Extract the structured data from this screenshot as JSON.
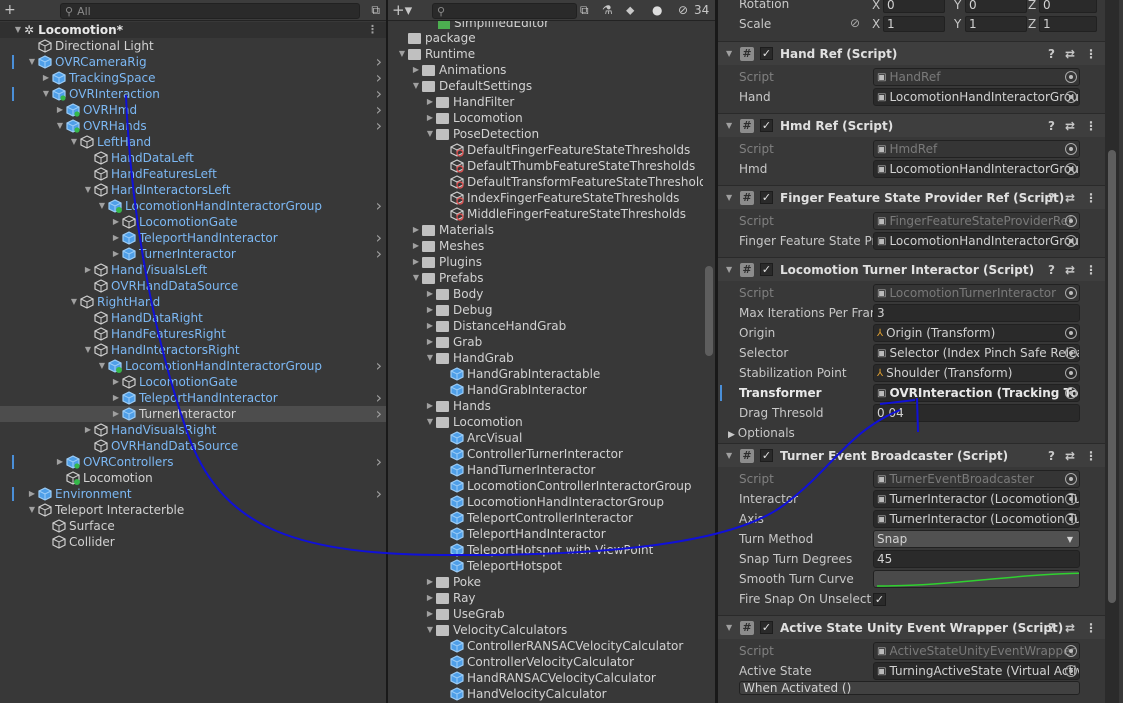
{
  "hierarchy": {
    "search_placeholder": "All",
    "scene": "Locomotion*",
    "rows": [
      {
        "label": "Directional Light",
        "indent": 1,
        "icon": "cube",
        "color": "white",
        "arrow": ""
      },
      {
        "label": "OVRCameraRig",
        "indent": 1,
        "icon": "prefab",
        "color": "blue",
        "arrow": "down",
        "chev": true,
        "mark": true
      },
      {
        "label": "TrackingSpace",
        "indent": 2,
        "icon": "prefab",
        "color": "blue",
        "arrow": "right",
        "chev": true
      },
      {
        "label": "OVRInteraction",
        "indent": 2,
        "icon": "prefab-mod",
        "color": "blue",
        "arrow": "down",
        "chev": true,
        "mark": true
      },
      {
        "label": "OVRHmd",
        "indent": 3,
        "icon": "prefab-mod",
        "color": "blue",
        "arrow": "right",
        "chev": true
      },
      {
        "label": "OVRHands",
        "indent": 3,
        "icon": "prefab-mod",
        "color": "blue",
        "arrow": "down",
        "chev": true
      },
      {
        "label": "LeftHand",
        "indent": 4,
        "icon": "cube",
        "color": "blue",
        "arrow": "down"
      },
      {
        "label": "HandDataLeft",
        "indent": 5,
        "icon": "cube",
        "color": "blue",
        "arrow": ""
      },
      {
        "label": "HandFeaturesLeft",
        "indent": 5,
        "icon": "cube",
        "color": "blue",
        "arrow": ""
      },
      {
        "label": "HandInteractorsLeft",
        "indent": 5,
        "icon": "cube",
        "color": "blue",
        "arrow": "down"
      },
      {
        "label": "LocomotionHandInteractorGroup",
        "indent": 6,
        "icon": "prefab-add",
        "color": "blue",
        "arrow": "down",
        "chev": true
      },
      {
        "label": "LocomotionGate",
        "indent": 7,
        "icon": "cube",
        "color": "blue",
        "arrow": "right"
      },
      {
        "label": "TeleportHandInteractor",
        "indent": 7,
        "icon": "prefab",
        "color": "blue",
        "arrow": "right",
        "chev": true
      },
      {
        "label": "TurnerInteractor",
        "indent": 7,
        "icon": "prefab",
        "color": "blue",
        "arrow": "right",
        "chev": true
      },
      {
        "label": "HandVisualsLeft",
        "indent": 5,
        "icon": "cube",
        "color": "blue",
        "arrow": "right"
      },
      {
        "label": "OVRHandDataSource",
        "indent": 5,
        "icon": "cube",
        "color": "blue",
        "arrow": ""
      },
      {
        "label": "RightHand",
        "indent": 4,
        "icon": "cube",
        "color": "blue",
        "arrow": "down"
      },
      {
        "label": "HandDataRight",
        "indent": 5,
        "icon": "cube",
        "color": "blue",
        "arrow": ""
      },
      {
        "label": "HandFeaturesRight",
        "indent": 5,
        "icon": "cube",
        "color": "blue",
        "arrow": ""
      },
      {
        "label": "HandInteractorsRight",
        "indent": 5,
        "icon": "cube",
        "color": "blue",
        "arrow": "down"
      },
      {
        "label": "LocomotionHandInteractorGroup",
        "indent": 6,
        "icon": "prefab-add",
        "color": "blue",
        "arrow": "down",
        "chev": true
      },
      {
        "label": "LocomotionGate",
        "indent": 7,
        "icon": "cube",
        "color": "blue",
        "arrow": "right"
      },
      {
        "label": "TeleportHandInteractor",
        "indent": 7,
        "icon": "prefab",
        "color": "blue",
        "arrow": "right",
        "chev": true
      },
      {
        "label": "TurnerInteractor",
        "indent": 7,
        "icon": "prefab",
        "color": "white",
        "arrow": "right",
        "chev": true,
        "selected": true
      },
      {
        "label": "HandVisualsRight",
        "indent": 5,
        "icon": "cube",
        "color": "blue",
        "arrow": "right"
      },
      {
        "label": "OVRHandDataSource",
        "indent": 5,
        "icon": "cube",
        "color": "blue",
        "arrow": ""
      },
      {
        "label": "OVRControllers",
        "indent": 3,
        "icon": "prefab-mod",
        "color": "blue",
        "arrow": "right",
        "chev": true,
        "mark": true
      },
      {
        "label": "Locomotion",
        "indent": 3,
        "icon": "cube-add",
        "color": "white",
        "arrow": ""
      },
      {
        "label": "Environment",
        "indent": 1,
        "icon": "prefab",
        "color": "blue",
        "arrow": "right",
        "chev": true,
        "mark": true
      },
      {
        "label": "Teleport Interacterble",
        "indent": 1,
        "icon": "cube",
        "color": "white",
        "arrow": "down"
      },
      {
        "label": "Surface",
        "indent": 2,
        "icon": "cube",
        "color": "white",
        "arrow": ""
      },
      {
        "label": "Collider",
        "indent": 2,
        "icon": "cube",
        "color": "white",
        "arrow": ""
      }
    ]
  },
  "project": {
    "hidden_count": "34",
    "top_partial": "SimplifiedEditor",
    "rows": [
      {
        "label": "package",
        "indent": 1,
        "icon": "folder",
        "arrow": ""
      },
      {
        "label": "Runtime",
        "indent": 1,
        "icon": "folder",
        "arrow": "down"
      },
      {
        "label": "Animations",
        "indent": 2,
        "icon": "folder",
        "arrow": "right"
      },
      {
        "label": "DefaultSettings",
        "indent": 2,
        "icon": "folder",
        "arrow": "down"
      },
      {
        "label": "HandFilter",
        "indent": 3,
        "icon": "folder",
        "arrow": "right"
      },
      {
        "label": "Locomotion",
        "indent": 3,
        "icon": "folder",
        "arrow": "right"
      },
      {
        "label": "PoseDetection",
        "indent": 3,
        "icon": "folder",
        "arrow": "down"
      },
      {
        "label": "DefaultFingerFeatureStateThresholds",
        "indent": 4,
        "icon": "asset",
        "arrow": ""
      },
      {
        "label": "DefaultThumbFeatureStateThresholds",
        "indent": 4,
        "icon": "asset",
        "arrow": ""
      },
      {
        "label": "DefaultTransformFeatureStateThresholds",
        "indent": 4,
        "icon": "asset",
        "arrow": ""
      },
      {
        "label": "IndexFingerFeatureStateThresholds",
        "indent": 4,
        "icon": "asset",
        "arrow": ""
      },
      {
        "label": "MiddleFingerFeatureStateThresholds",
        "indent": 4,
        "icon": "asset",
        "arrow": ""
      },
      {
        "label": "Materials",
        "indent": 2,
        "icon": "folder",
        "arrow": "right"
      },
      {
        "label": "Meshes",
        "indent": 2,
        "icon": "folder",
        "arrow": "right"
      },
      {
        "label": "Plugins",
        "indent": 2,
        "icon": "folder",
        "arrow": "right"
      },
      {
        "label": "Prefabs",
        "indent": 2,
        "icon": "folder",
        "arrow": "down"
      },
      {
        "label": "Body",
        "indent": 3,
        "icon": "folder",
        "arrow": "right"
      },
      {
        "label": "Debug",
        "indent": 3,
        "icon": "folder",
        "arrow": "right"
      },
      {
        "label": "DistanceHandGrab",
        "indent": 3,
        "icon": "folder",
        "arrow": "right"
      },
      {
        "label": "Grab",
        "indent": 3,
        "icon": "folder",
        "arrow": "right"
      },
      {
        "label": "HandGrab",
        "indent": 3,
        "icon": "folder",
        "arrow": "down"
      },
      {
        "label": "HandGrabInteractable",
        "indent": 4,
        "icon": "prefab",
        "arrow": ""
      },
      {
        "label": "HandGrabInteractor",
        "indent": 4,
        "icon": "prefab",
        "arrow": ""
      },
      {
        "label": "Hands",
        "indent": 3,
        "icon": "folder",
        "arrow": "right"
      },
      {
        "label": "Locomotion",
        "indent": 3,
        "icon": "folder",
        "arrow": "down"
      },
      {
        "label": "ArcVisual",
        "indent": 4,
        "icon": "prefab",
        "arrow": ""
      },
      {
        "label": "ControllerTurnerInteractor",
        "indent": 4,
        "icon": "prefab",
        "arrow": ""
      },
      {
        "label": "HandTurnerInteractor",
        "indent": 4,
        "icon": "prefab",
        "arrow": ""
      },
      {
        "label": "LocomotionControllerInteractorGroup",
        "indent": 4,
        "icon": "prefab",
        "arrow": ""
      },
      {
        "label": "LocomotionHandInteractorGroup",
        "indent": 4,
        "icon": "prefab",
        "arrow": ""
      },
      {
        "label": "TeleportControllerInteractor",
        "indent": 4,
        "icon": "prefab",
        "arrow": ""
      },
      {
        "label": "TeleportHandInteractor",
        "indent": 4,
        "icon": "prefab",
        "arrow": ""
      },
      {
        "label": "TeleportHotspot with ViewPoint",
        "indent": 4,
        "icon": "prefab",
        "arrow": ""
      },
      {
        "label": "TeleportHotspot",
        "indent": 4,
        "icon": "prefab",
        "arrow": ""
      },
      {
        "label": "Poke",
        "indent": 3,
        "icon": "folder",
        "arrow": "right"
      },
      {
        "label": "Ray",
        "indent": 3,
        "icon": "folder",
        "arrow": "right"
      },
      {
        "label": "UseGrab",
        "indent": 3,
        "icon": "folder",
        "arrow": "right"
      },
      {
        "label": "VelocityCalculators",
        "indent": 3,
        "icon": "folder",
        "arrow": "down"
      },
      {
        "label": "ControllerRANSACVelocityCalculator",
        "indent": 4,
        "icon": "prefab",
        "arrow": ""
      },
      {
        "label": "ControllerVelocityCalculator",
        "indent": 4,
        "icon": "prefab",
        "arrow": ""
      },
      {
        "label": "HandRANSACVelocityCalculator",
        "indent": 4,
        "icon": "prefab",
        "arrow": ""
      },
      {
        "label": "HandVelocityCalculator",
        "indent": 4,
        "icon": "prefab",
        "arrow": ""
      }
    ]
  },
  "inspector": {
    "transform": {
      "rotation_label": "Rotation",
      "scale_label": "Scale",
      "rotation": {
        "x": "0",
        "y": "0",
        "z": "0"
      },
      "scale": {
        "x": "1",
        "y": "1",
        "z": "1"
      },
      "x": "X",
      "y": "Y",
      "z": "Z"
    },
    "components": [
      {
        "title": "Hand Ref (Script)",
        "props": [
          {
            "label": "Script",
            "value": "HandRef",
            "dim": true
          },
          {
            "label": "Hand",
            "value": "LocomotionHandInteractorGroup ("
          }
        ]
      },
      {
        "title": "Hmd Ref (Script)",
        "props": [
          {
            "label": "Script",
            "value": "HmdRef",
            "dim": true
          },
          {
            "label": "Hmd",
            "value": "LocomotionHandInteractorGroup ("
          }
        ]
      },
      {
        "title": "Finger Feature State Provider Ref (Script)",
        "props": [
          {
            "label": "Script",
            "value": "FingerFeatureStateProviderRef",
            "dim": true
          },
          {
            "label": "Finger Feature State Pro",
            "value": "LocomotionHandInteractorGroup ("
          }
        ]
      },
      {
        "title": "Locomotion Turner Interactor (Script)",
        "props": [
          {
            "label": "Script",
            "value": "LocomotionTurnerInteractor",
            "dim": true
          },
          {
            "label": "Max Iterations Per Fram",
            "value": "3",
            "plain": true
          },
          {
            "label": "Origin",
            "value": "Origin (Transform)",
            "tf": true
          },
          {
            "label": "Selector",
            "value": "Selector (Index Pinch Safe Release"
          },
          {
            "label": "Stabilization Point",
            "value": "Shoulder (Transform)",
            "tf": true
          },
          {
            "label": "Transformer",
            "value": "OVRInteraction (Tracking To Wor",
            "bold": true
          },
          {
            "label": "Drag Thresold",
            "value": "0.04",
            "plain": true
          },
          {
            "label": "Optionals",
            "value": "",
            "foldout": true
          }
        ]
      },
      {
        "title": "Turner Event Broadcaster (Script)",
        "props": [
          {
            "label": "Script",
            "value": "TurnerEventBroadcaster",
            "dim": true
          },
          {
            "label": "Interactor",
            "value": "TurnerInteractor (Locomotion Turr"
          },
          {
            "label": "Axis",
            "value": "TurnerInteractor (Locomotion Turr"
          },
          {
            "label": "Turn Method",
            "value": "Snap",
            "dropdown": true
          },
          {
            "label": "Snap Turn Degrees",
            "value": "45",
            "plain": true
          },
          {
            "label": "Smooth Turn Curve",
            "value": "",
            "curve": true
          },
          {
            "label": "Fire Snap On Unselect",
            "value": "✓",
            "check": true
          }
        ]
      },
      {
        "title": "Active State Unity Event Wrapper (Script)",
        "props": [
          {
            "label": "Script",
            "value": "ActiveStateUnityEventWrapper",
            "dim": true
          },
          {
            "label": "Active State",
            "value": "TurningActiveState (Virtual Active"
          }
        ]
      }
    ],
    "bottom_partial": "When Activated ()"
  }
}
